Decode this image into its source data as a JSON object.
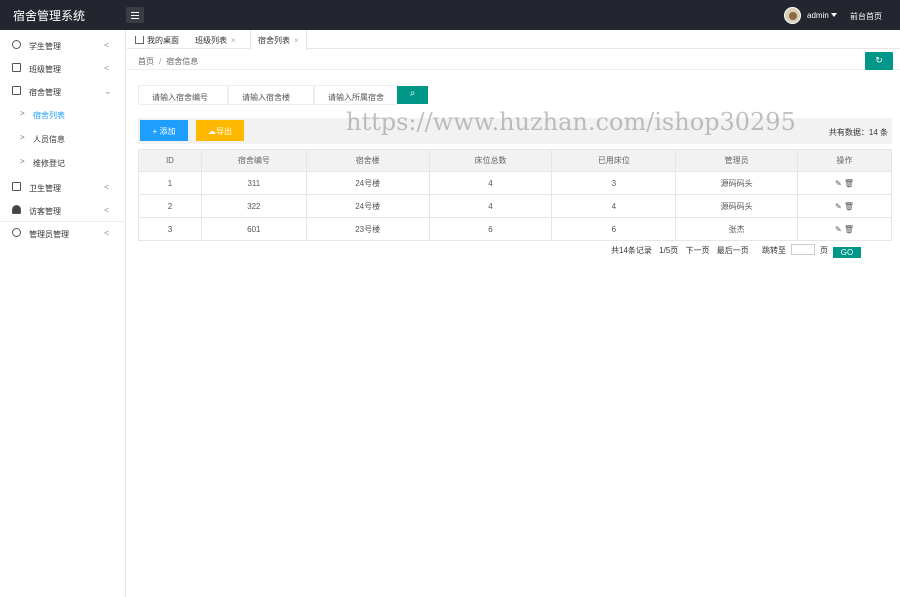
{
  "header": {
    "app_title": "宿舍管理系统",
    "user_name": "admin",
    "front_link": "前台首页"
  },
  "sidebar": {
    "items": [
      {
        "label": "学生管理",
        "icon": "user-icon"
      },
      {
        "label": "班级管理",
        "icon": "class-icon"
      },
      {
        "label": "宿舍管理",
        "icon": "dorm-icon"
      },
      {
        "label": "卫生管理",
        "icon": "hygiene-icon"
      },
      {
        "label": "访客管理",
        "icon": "visitors-icon"
      },
      {
        "label": "管理员管理",
        "icon": "admin-icon"
      }
    ],
    "sub_items": [
      {
        "label": "宿舍列表",
        "active": true
      },
      {
        "label": "人员信息",
        "active": false
      },
      {
        "label": "维修登记",
        "active": false
      }
    ]
  },
  "tabs": [
    {
      "label": "我的桌面"
    },
    {
      "label": "班级列表"
    },
    {
      "label": "宿舍列表"
    }
  ],
  "breadcrumb": {
    "home": "首页",
    "current": "宿舍信息"
  },
  "search": {
    "fields": [
      {
        "placeholder": "请输入宿舍编号"
      },
      {
        "placeholder": "请输入宿舍楼"
      },
      {
        "placeholder": "请输入所属宿舍"
      }
    ],
    "button_icon": "search-icon"
  },
  "toolbar": {
    "add_label": "添加",
    "export_label": "导出",
    "total_text": "共有数据：14 条"
  },
  "table": {
    "headers": [
      "ID",
      "宿舍编号",
      "宿舍楼",
      "床位总数",
      "已用床位",
      "管理员",
      "操作"
    ],
    "rows": [
      [
        "1",
        "311",
        "24号楼",
        "4",
        "3",
        "源码码头"
      ],
      [
        "2",
        "322",
        "24号楼",
        "4",
        "4",
        "源码码头"
      ],
      [
        "3",
        "601",
        "23号楼",
        "6",
        "6",
        "张杰"
      ]
    ]
  },
  "pager": {
    "summary": "共14条记录",
    "page_info": "1/5页",
    "next": "下一页",
    "last": "最后一页",
    "jump_to": "跳转至",
    "page_unit": "页",
    "go": "GO"
  },
  "watermark": "https://www.huzhan.com/ishop30295",
  "colors": {
    "header_bg": "#23262e",
    "primary": "#1e9fff",
    "export": "#ffb800",
    "teal": "#009688"
  }
}
